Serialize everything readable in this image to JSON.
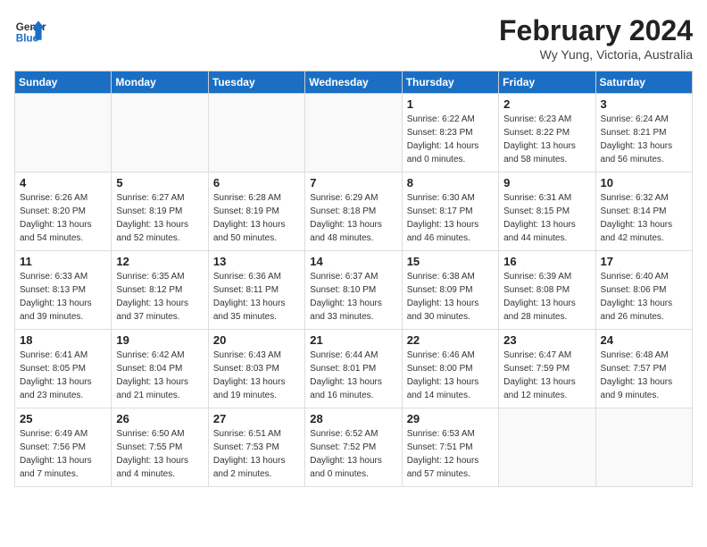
{
  "header": {
    "logo_line1": "General",
    "logo_line2": "Blue",
    "month_year": "February 2024",
    "location": "Wy Yung, Victoria, Australia"
  },
  "days_of_week": [
    "Sunday",
    "Monday",
    "Tuesday",
    "Wednesday",
    "Thursday",
    "Friday",
    "Saturday"
  ],
  "weeks": [
    [
      {
        "day": "",
        "info": ""
      },
      {
        "day": "",
        "info": ""
      },
      {
        "day": "",
        "info": ""
      },
      {
        "day": "",
        "info": ""
      },
      {
        "day": "1",
        "info": "Sunrise: 6:22 AM\nSunset: 8:23 PM\nDaylight: 14 hours\nand 0 minutes."
      },
      {
        "day": "2",
        "info": "Sunrise: 6:23 AM\nSunset: 8:22 PM\nDaylight: 13 hours\nand 58 minutes."
      },
      {
        "day": "3",
        "info": "Sunrise: 6:24 AM\nSunset: 8:21 PM\nDaylight: 13 hours\nand 56 minutes."
      }
    ],
    [
      {
        "day": "4",
        "info": "Sunrise: 6:26 AM\nSunset: 8:20 PM\nDaylight: 13 hours\nand 54 minutes."
      },
      {
        "day": "5",
        "info": "Sunrise: 6:27 AM\nSunset: 8:19 PM\nDaylight: 13 hours\nand 52 minutes."
      },
      {
        "day": "6",
        "info": "Sunrise: 6:28 AM\nSunset: 8:19 PM\nDaylight: 13 hours\nand 50 minutes."
      },
      {
        "day": "7",
        "info": "Sunrise: 6:29 AM\nSunset: 8:18 PM\nDaylight: 13 hours\nand 48 minutes."
      },
      {
        "day": "8",
        "info": "Sunrise: 6:30 AM\nSunset: 8:17 PM\nDaylight: 13 hours\nand 46 minutes."
      },
      {
        "day": "9",
        "info": "Sunrise: 6:31 AM\nSunset: 8:15 PM\nDaylight: 13 hours\nand 44 minutes."
      },
      {
        "day": "10",
        "info": "Sunrise: 6:32 AM\nSunset: 8:14 PM\nDaylight: 13 hours\nand 42 minutes."
      }
    ],
    [
      {
        "day": "11",
        "info": "Sunrise: 6:33 AM\nSunset: 8:13 PM\nDaylight: 13 hours\nand 39 minutes."
      },
      {
        "day": "12",
        "info": "Sunrise: 6:35 AM\nSunset: 8:12 PM\nDaylight: 13 hours\nand 37 minutes."
      },
      {
        "day": "13",
        "info": "Sunrise: 6:36 AM\nSunset: 8:11 PM\nDaylight: 13 hours\nand 35 minutes."
      },
      {
        "day": "14",
        "info": "Sunrise: 6:37 AM\nSunset: 8:10 PM\nDaylight: 13 hours\nand 33 minutes."
      },
      {
        "day": "15",
        "info": "Sunrise: 6:38 AM\nSunset: 8:09 PM\nDaylight: 13 hours\nand 30 minutes."
      },
      {
        "day": "16",
        "info": "Sunrise: 6:39 AM\nSunset: 8:08 PM\nDaylight: 13 hours\nand 28 minutes."
      },
      {
        "day": "17",
        "info": "Sunrise: 6:40 AM\nSunset: 8:06 PM\nDaylight: 13 hours\nand 26 minutes."
      }
    ],
    [
      {
        "day": "18",
        "info": "Sunrise: 6:41 AM\nSunset: 8:05 PM\nDaylight: 13 hours\nand 23 minutes."
      },
      {
        "day": "19",
        "info": "Sunrise: 6:42 AM\nSunset: 8:04 PM\nDaylight: 13 hours\nand 21 minutes."
      },
      {
        "day": "20",
        "info": "Sunrise: 6:43 AM\nSunset: 8:03 PM\nDaylight: 13 hours\nand 19 minutes."
      },
      {
        "day": "21",
        "info": "Sunrise: 6:44 AM\nSunset: 8:01 PM\nDaylight: 13 hours\nand 16 minutes."
      },
      {
        "day": "22",
        "info": "Sunrise: 6:46 AM\nSunset: 8:00 PM\nDaylight: 13 hours\nand 14 minutes."
      },
      {
        "day": "23",
        "info": "Sunrise: 6:47 AM\nSunset: 7:59 PM\nDaylight: 13 hours\nand 12 minutes."
      },
      {
        "day": "24",
        "info": "Sunrise: 6:48 AM\nSunset: 7:57 PM\nDaylight: 13 hours\nand 9 minutes."
      }
    ],
    [
      {
        "day": "25",
        "info": "Sunrise: 6:49 AM\nSunset: 7:56 PM\nDaylight: 13 hours\nand 7 minutes."
      },
      {
        "day": "26",
        "info": "Sunrise: 6:50 AM\nSunset: 7:55 PM\nDaylight: 13 hours\nand 4 minutes."
      },
      {
        "day": "27",
        "info": "Sunrise: 6:51 AM\nSunset: 7:53 PM\nDaylight: 13 hours\nand 2 minutes."
      },
      {
        "day": "28",
        "info": "Sunrise: 6:52 AM\nSunset: 7:52 PM\nDaylight: 13 hours\nand 0 minutes."
      },
      {
        "day": "29",
        "info": "Sunrise: 6:53 AM\nSunset: 7:51 PM\nDaylight: 12 hours\nand 57 minutes."
      },
      {
        "day": "",
        "info": ""
      },
      {
        "day": "",
        "info": ""
      }
    ]
  ]
}
